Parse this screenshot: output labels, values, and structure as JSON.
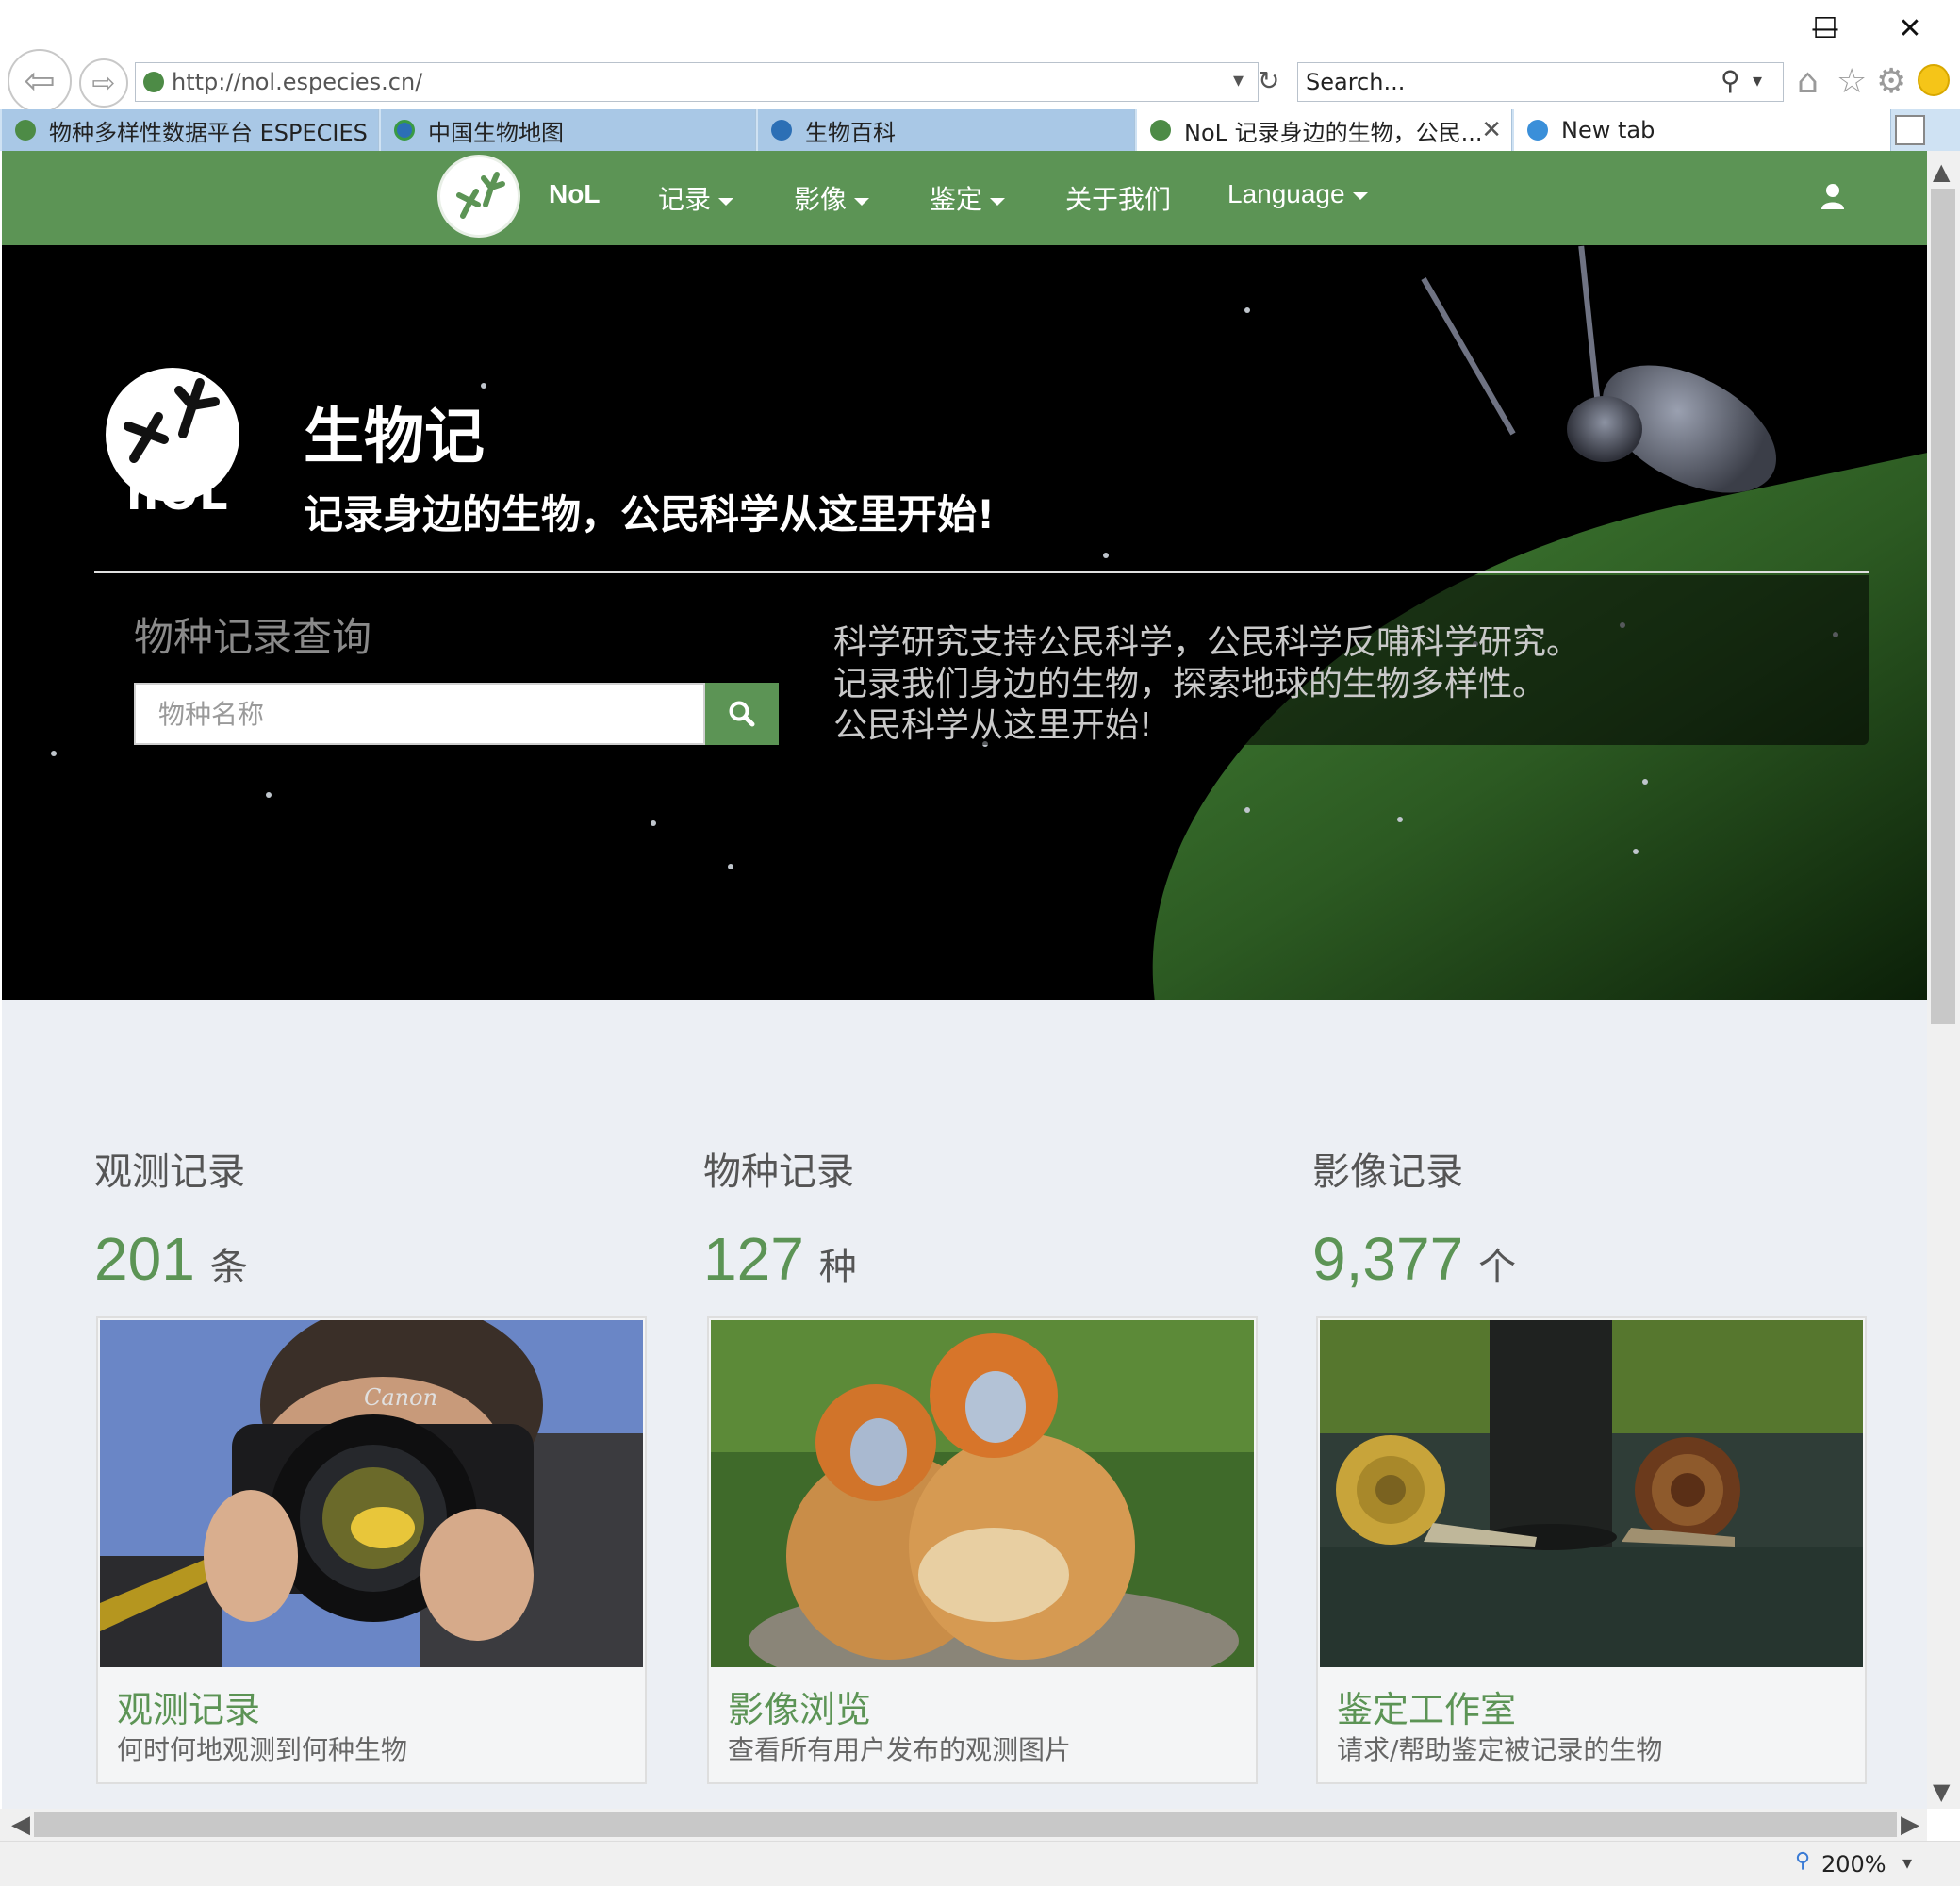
{
  "browser": {
    "window_controls": {
      "minimize": "—",
      "maximize": "☐",
      "close": "✕"
    },
    "address": "http://nol.especies.cn/",
    "search_placeholder": "Search...",
    "tabs": [
      {
        "label": "物种多样性数据平台 ESPECIES",
        "active": false
      },
      {
        "label": "中国生物地图",
        "active": false
      },
      {
        "label": "生物百科",
        "active": false
      },
      {
        "label": "NoL 记录身边的生物，公民...",
        "active": true
      },
      {
        "label": "New tab",
        "active": false
      }
    ],
    "zoom": "200%"
  },
  "site": {
    "colors": {
      "primary": "#5c9455",
      "hero_bg": "#000000",
      "page_bg": "#eceff4"
    },
    "nav": {
      "brand": "NoL",
      "items": [
        {
          "label": "记录",
          "dropdown": true
        },
        {
          "label": "影像",
          "dropdown": true
        },
        {
          "label": "鉴定",
          "dropdown": true
        },
        {
          "label": "关于我们",
          "dropdown": false
        },
        {
          "label": "Language",
          "dropdown": true
        }
      ],
      "user_icon": "user-icon"
    },
    "hero": {
      "logo_text": "nOL",
      "title": "生物记",
      "subtitle": "记录身边的生物，公民科学从这里开始!",
      "search_heading": "物种记录查询",
      "search_placeholder": "物种名称",
      "description_lines": [
        "科学研究支持公民科学，公民科学反哺科学研究。",
        "记录我们身边的生物，探索地球的生物多样性。",
        "公民科学从这里开始!"
      ]
    },
    "stats": [
      {
        "label": "观测记录",
        "value": "201",
        "unit": "条"
      },
      {
        "label": "物种记录",
        "value": "127",
        "unit": "种"
      },
      {
        "label": "影像记录",
        "value": "9,377",
        "unit": "个"
      }
    ],
    "cards": [
      {
        "title": "观测记录",
        "desc": "何时何地观测到何种生物",
        "image": "photographer-with-camera"
      },
      {
        "title": "影像浏览",
        "desc": "查看所有用户发布的观测图片",
        "image": "golden-snub-nosed-monkeys"
      },
      {
        "title": "鉴定工作室",
        "desc": "请求/帮助鉴定被记录的生物",
        "image": "snails-on-post"
      }
    ]
  }
}
